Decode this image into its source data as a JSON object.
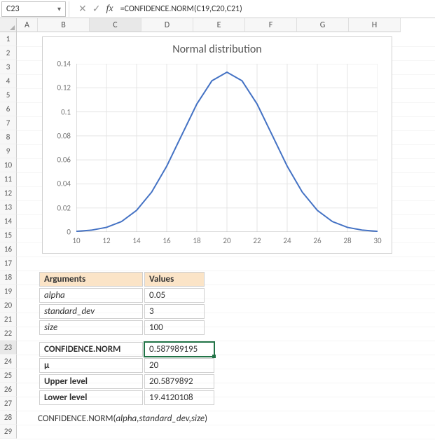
{
  "name_box": "C23",
  "formula_bar": {
    "fx_label": "fx",
    "value": "=CONFIDENCE.NORM(C19,C20,C21)"
  },
  "columns": [
    "A",
    "B",
    "C",
    "D",
    "E",
    "F",
    "G",
    "H"
  ],
  "rows": [
    "1",
    "2",
    "3",
    "4",
    "5",
    "6",
    "7",
    "8",
    "9",
    "10",
    "11",
    "12",
    "13",
    "14",
    "15",
    "16",
    "17",
    "18",
    "19",
    "20",
    "21",
    "22",
    "23",
    "24",
    "25",
    "26",
    "27",
    "28",
    "29"
  ],
  "chart_data": {
    "type": "line",
    "title": "Normal distribution",
    "xlabel": "",
    "ylabel": "",
    "xlim": [
      10,
      30
    ],
    "ylim": [
      0,
      0.14
    ],
    "x_ticks": [
      10,
      12,
      14,
      16,
      18,
      20,
      22,
      24,
      26,
      28,
      30
    ],
    "y_ticks": [
      0,
      0.02,
      0.04,
      0.06,
      0.08,
      0.1,
      0.12,
      0.14
    ],
    "x": [
      10,
      11,
      12,
      13,
      14,
      15,
      16,
      17,
      18,
      19,
      20,
      21,
      22,
      23,
      24,
      25,
      26,
      27,
      28,
      29,
      30
    ],
    "values": [
      0.0005,
      0.0015,
      0.0038,
      0.0087,
      0.018,
      0.0332,
      0.0547,
      0.0807,
      0.1065,
      0.1258,
      0.133,
      0.1258,
      0.1065,
      0.0807,
      0.0547,
      0.0332,
      0.018,
      0.0087,
      0.0038,
      0.0015,
      0.0005
    ]
  },
  "args_table": {
    "headers": {
      "arg": "Arguments",
      "val": "Values"
    },
    "rows": [
      {
        "name": "alpha",
        "value": "0.05"
      },
      {
        "name": "standard_dev",
        "value": "3"
      },
      {
        "name": "size",
        "value": "100"
      }
    ]
  },
  "result_table": {
    "rows": [
      {
        "name": "CONFIDENCE.NORM",
        "value": "0.587989195",
        "bold": true,
        "active": true
      },
      {
        "name": "μ",
        "value": "20",
        "bold": true
      },
      {
        "name": "Upper level",
        "value": "20.5879892",
        "bold": true
      },
      {
        "name": "Lower level",
        "value": "19.4120108",
        "bold": true
      }
    ]
  },
  "syntax": {
    "fn": "CONFIDENCE.NORM(",
    "args": "alpha,standard_dev,size",
    "close": ")"
  }
}
